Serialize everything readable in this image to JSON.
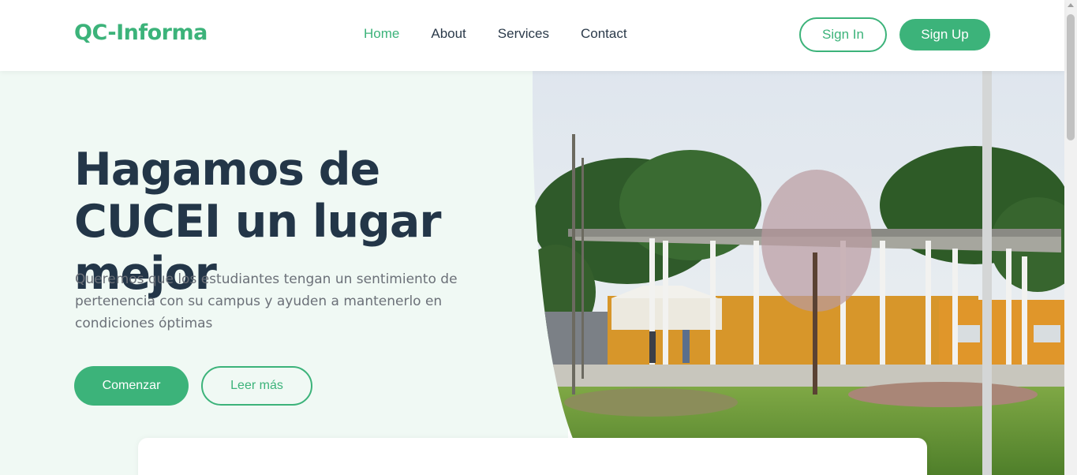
{
  "brand": {
    "logo_text": "QC-Informa",
    "accent_color": "#3cb37a"
  },
  "nav": {
    "items": [
      {
        "label": "Home",
        "active": true
      },
      {
        "label": "About",
        "active": false
      },
      {
        "label": "Services",
        "active": false
      },
      {
        "label": "Contact",
        "active": false
      }
    ],
    "sign_in_label": "Sign In",
    "sign_up_label": "Sign Up"
  },
  "hero": {
    "title": "Hagamos de CUCEI un lugar mejor",
    "description": "Queremos que los estudiantes tengan un sentimiento de pertenencia con su campus y ayuden a mantenerlo en condiciones óptimas",
    "primary_button": "Comenzar",
    "secondary_button": "Leer más",
    "image_subject": "campus-photo"
  }
}
